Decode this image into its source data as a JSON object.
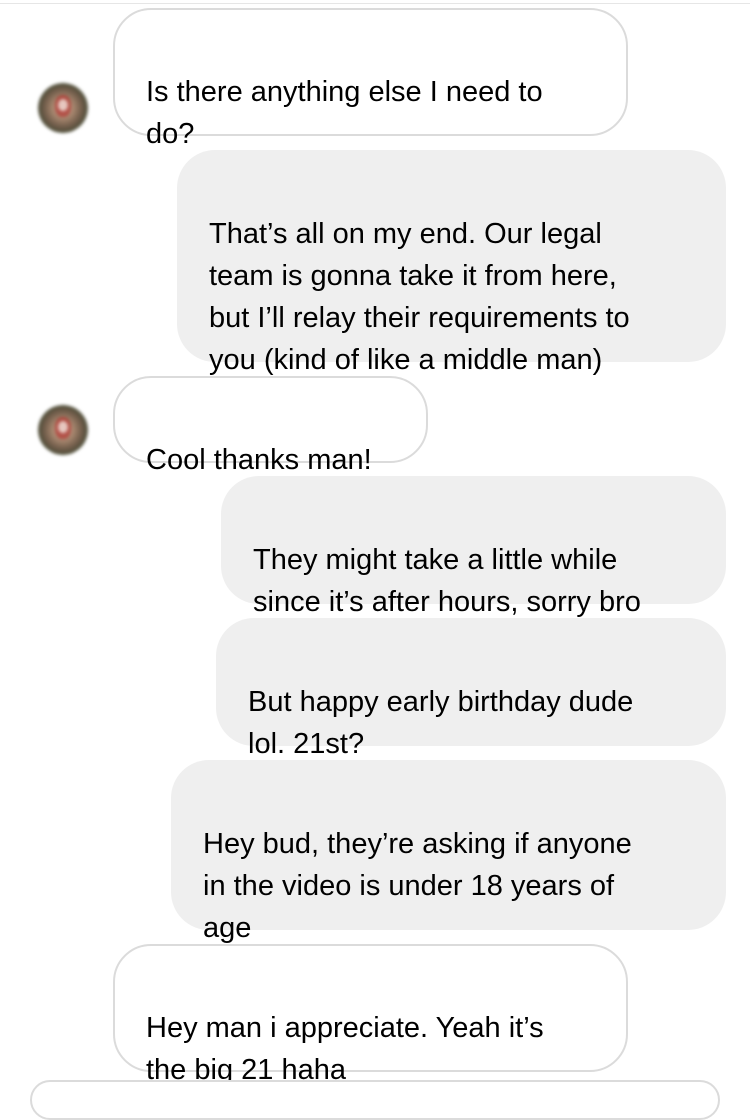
{
  "thread": {
    "messages": [
      {
        "direction": "incoming",
        "text": "Is there anything else I need to\ndo?"
      },
      {
        "direction": "outgoing",
        "text": "That’s all on my end. Our legal\nteam is gonna take it from here,\nbut I’ll relay their requirements to\nyou (kind of like a middle man)"
      },
      {
        "direction": "incoming",
        "text": "Cool thanks man!"
      },
      {
        "direction": "outgoing",
        "text": "They might take a little while\nsince it’s after hours, sorry bro"
      },
      {
        "direction": "outgoing",
        "text": "But happy early birthday dude\nlol. 21st?"
      },
      {
        "direction": "outgoing",
        "text": "Hey bud, they’re asking if anyone\nin the video is under 18 years of\nage"
      },
      {
        "direction": "incoming",
        "text": "Hey man i appreciate. Yeah it’s\nthe big 21 haha"
      }
    ]
  },
  "colors": {
    "incoming_bubble_bg": "#ffffff",
    "incoming_bubble_border": "#dbdbdb",
    "outgoing_bubble_bg": "#efefef",
    "text": "#000000"
  },
  "icons": {
    "avatar": "blurred-profile-avatar"
  }
}
